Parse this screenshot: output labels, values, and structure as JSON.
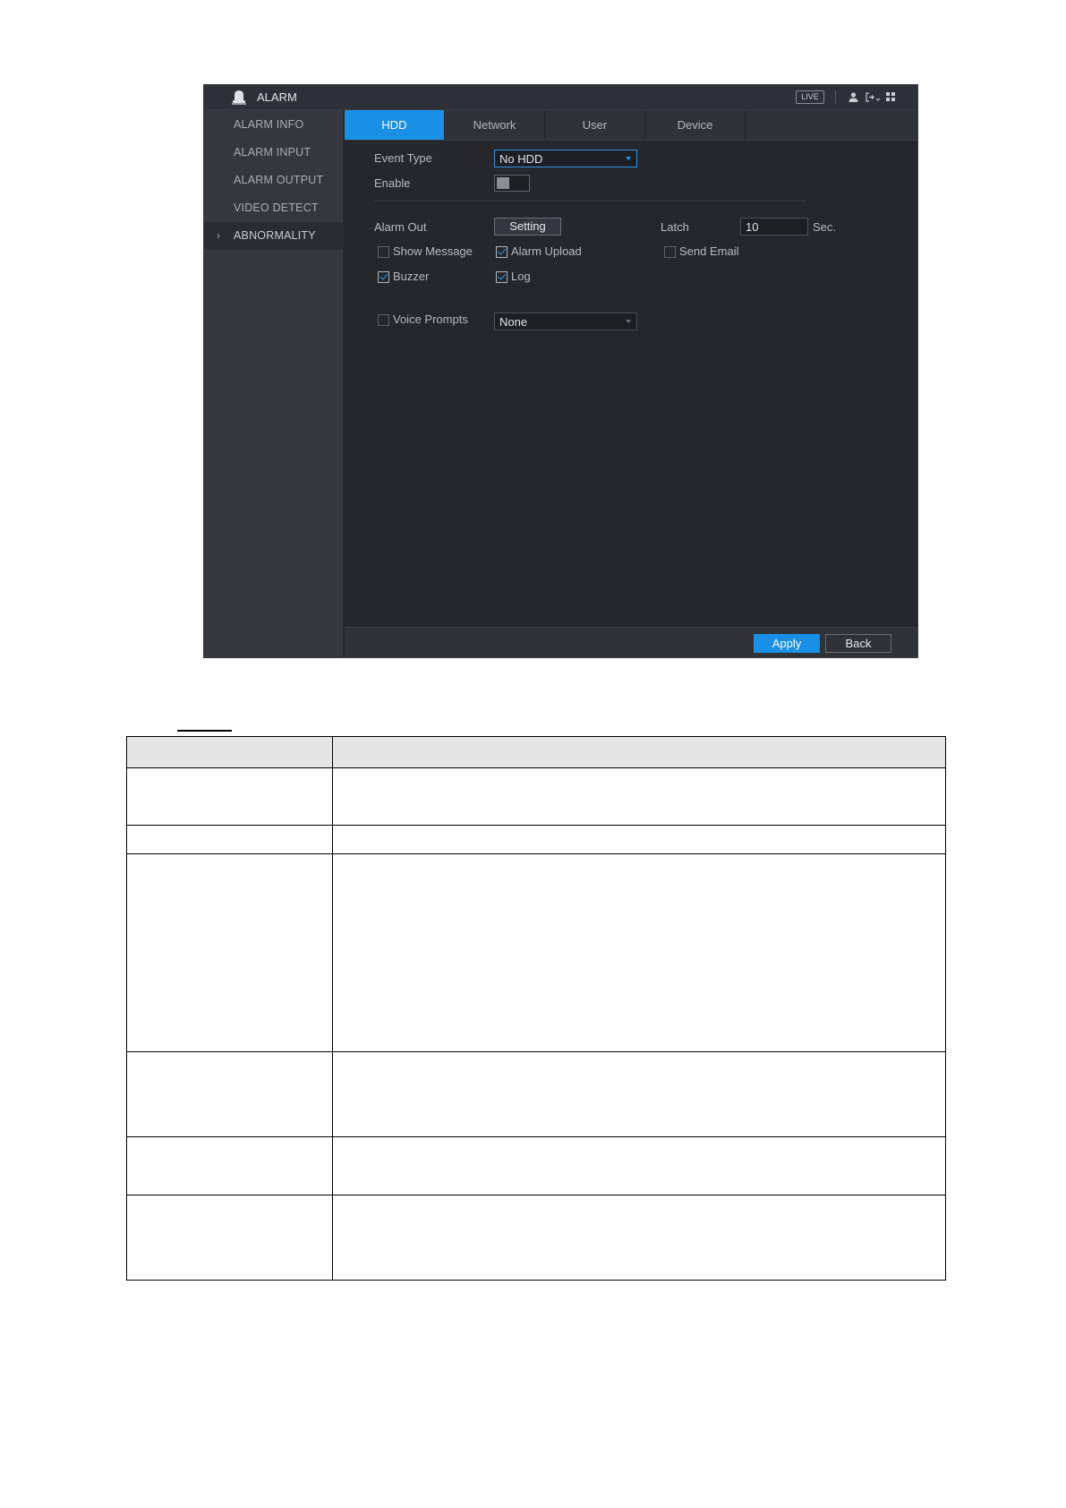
{
  "window": {
    "title": "ALARM",
    "live_badge": "LIVE",
    "icons": [
      "bell-icon",
      "user-icon",
      "logout-icon",
      "grid-icon"
    ]
  },
  "sidebar": {
    "items": [
      {
        "label": "ALARM INFO"
      },
      {
        "label": "ALARM INPUT"
      },
      {
        "label": "ALARM OUTPUT"
      },
      {
        "label": "VIDEO DETECT"
      },
      {
        "label": "ABNORMALITY",
        "active": true
      }
    ]
  },
  "tabs": [
    {
      "label": "HDD",
      "active": true
    },
    {
      "label": "Network"
    },
    {
      "label": "User"
    },
    {
      "label": "Device"
    }
  ],
  "form": {
    "event_type_label": "Event Type",
    "event_type_value": "No HDD",
    "enable_label": "Enable",
    "enable_on": false,
    "alarm_out_label": "Alarm Out",
    "setting_button": "Setting",
    "latch_label": "Latch",
    "latch_value": "10",
    "latch_unit": "Sec.",
    "checkboxes": [
      {
        "label": "Show Message",
        "checked": false
      },
      {
        "label": "Alarm Upload",
        "checked": true
      },
      {
        "label": "Send Email",
        "checked": false
      },
      {
        "label": "Buzzer",
        "checked": true
      },
      {
        "label": "Log",
        "checked": true
      },
      {
        "label": "Voice Prompts",
        "checked": false
      }
    ],
    "voice_prompts_value": "None"
  },
  "footer": {
    "apply_button": "Apply",
    "back_button": "Back"
  },
  "colors": {
    "accent": "#1a8fe6",
    "window_bg": "#25272c",
    "sidebar_bg": "#35373d"
  },
  "document_table": {
    "rows": 6,
    "row_heights_note_removed": true
  }
}
